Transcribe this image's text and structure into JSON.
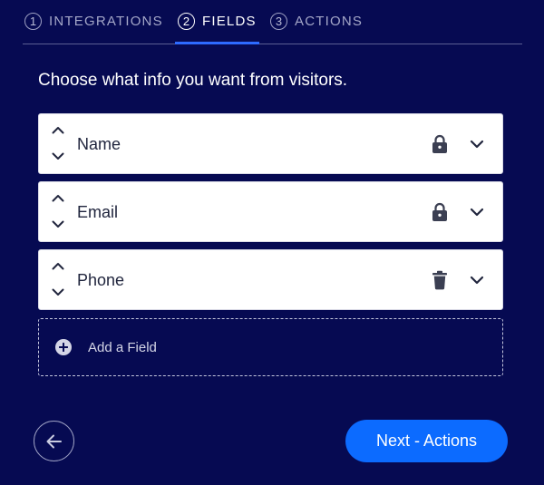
{
  "stepper": {
    "steps": [
      {
        "number": "1",
        "label": "INTEGRATIONS",
        "active": false
      },
      {
        "number": "2",
        "label": "FIELDS",
        "active": true
      },
      {
        "number": "3",
        "label": "ACTIONS",
        "active": false
      }
    ]
  },
  "heading": "Choose what info you want from visitors.",
  "fields": [
    {
      "name": "Name",
      "state_icon": "lock-icon"
    },
    {
      "name": "Email",
      "state_icon": "lock-icon"
    },
    {
      "name": "Phone",
      "state_icon": "trash-icon"
    }
  ],
  "add_field": {
    "label": "Add a Field",
    "icon": "plus-circle-icon"
  },
  "footer": {
    "back_icon": "arrow-left-icon",
    "next_label": "Next - Actions"
  },
  "colors": {
    "background": "#060a52",
    "accent": "#0c6bff",
    "active_tab_underline": "#2e6bff",
    "field_background": "#ffffff",
    "field_text": "#20253d"
  }
}
